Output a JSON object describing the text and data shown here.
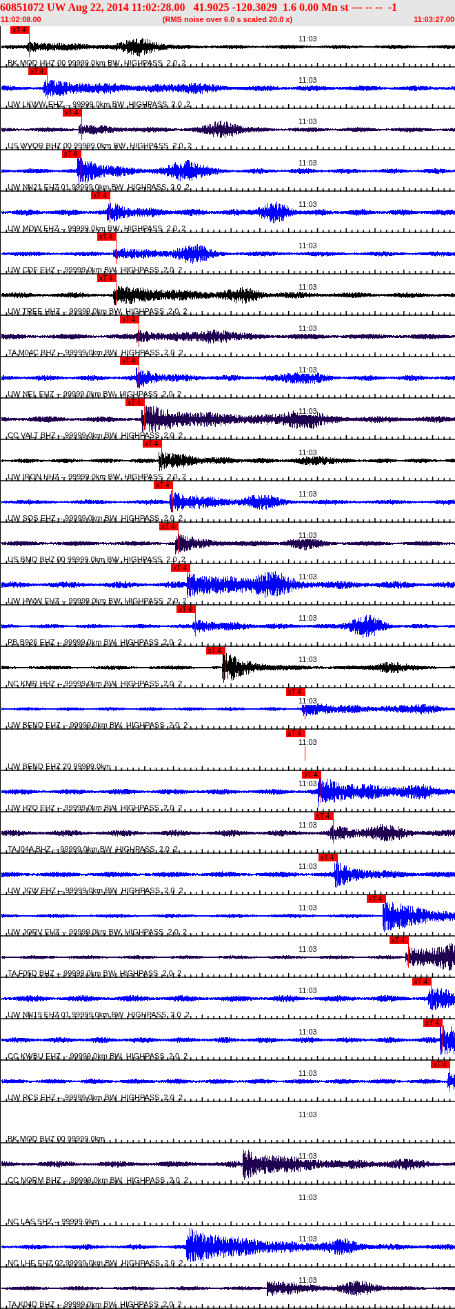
{
  "header": {
    "title": "60851072 UW Aug 22, 2014 11:02:28.00   41.9025 -120.3029  1.6 0.00 Mn st --- -- --  -1",
    "start_time": "11:02:08.00",
    "note": "(RMS noise over 6.0 s scaled 20.0 x)",
    "end_time": "11:03:27.00"
  },
  "traces": [
    {
      "kind": "trace",
      "label": "BK MOD HHZ 00 99999.0km BW  HIGHPASS  2.0  2",
      "color": "#000000",
      "time_mark": "11:03",
      "pick": "xT 4",
      "level": 0.064
    },
    {
      "kind": "trace",
      "label": "UW LKWW EHZ -- 99999.0km BW  HIGHPASS  2.0  2",
      "color": "#0000ff",
      "time_mark": "11:03",
      "pick": "xT 4",
      "level": 0.103
    },
    {
      "kind": "trace",
      "label": "US WVOR BHZ 00 99999.0km BW  HIGHPASS  2.0  2",
      "color": "#200050",
      "time_mark": "11:03",
      "pick": "xT 4",
      "level": 0.179
    },
    {
      "kind": "trace",
      "label": "UW NN21 EHZ 01 99999.0km BW  HIGHPASS  2.0  2",
      "color": "#0000ff",
      "time_mark": "11:03",
      "pick": "xT 4",
      "level": 0.177
    },
    {
      "kind": "trace",
      "label": "UW MDW EHZ -- 99999.0km BW  HIGHPASS  2.0  2",
      "color": "#0000ff",
      "time_mark": "11:03",
      "pick": "xT 4",
      "level": 0.242
    },
    {
      "kind": "trace",
      "label": "UW CDF EHZ -- 99999.0km BW  HIGHPASS  2.0  2",
      "color": "#0000ff",
      "time_mark": "11:03",
      "pick": "xT 4",
      "level": 0.255
    },
    {
      "kind": "trace",
      "label": "UW TREE HHZ -- 99999.0km BW  HIGHPASS  2.0  2",
      "color": "#000000",
      "time_mark": "11:03",
      "pick": "xT 4",
      "level": 0.255
    },
    {
      "kind": "trace",
      "label": "TA M04C BHZ -- 99999.0km BW  HIGHPASS  2.0  2",
      "color": "#200050",
      "time_mark": "11:03",
      "pick": "xT 4",
      "level": 0.305
    },
    {
      "kind": "trace",
      "label": "UW NEL EHZ -- 99999.0km BW  HIGHPASS  2.0  2",
      "color": "#0000ff",
      "time_mark": "11:03",
      "pick": "xT 4",
      "level": 0.305
    },
    {
      "kind": "trace",
      "label": "CC VALT BHZ -- 99999.0km BW  HIGHPASS  2.0  2",
      "color": "#200050",
      "time_mark": "11:03",
      "pick": "xT 4",
      "level": 0.317
    },
    {
      "kind": "trace",
      "label": "UW IRON HHZ -- 99999.0km BW  HIGHPASS  2.0  2",
      "color": "#000000",
      "time_mark": "11:03",
      "pick": "xT 4",
      "level": 0.355
    },
    {
      "kind": "trace",
      "label": "UW SOS EHZ -- 99999.0km BW  HIGHPASS  2.0  2",
      "color": "#0000ff",
      "time_mark": "11:03",
      "pick": "xT 4",
      "level": 0.38
    },
    {
      "kind": "trace",
      "label": "US BMO BHZ 00 99999.0km BW  HIGHPASS  2.0  2",
      "color": "#200050",
      "time_mark": "11:03",
      "pick": "xT 4",
      "level": 0.392
    },
    {
      "kind": "trace",
      "label": "UW HWW EHZ -- 99999.0km BW  HIGHPASS  2.0  2",
      "color": "#0000ff",
      "time_mark": "11:03",
      "pick": "xT 4",
      "level": 0.418
    },
    {
      "kind": "trace",
      "label": "PB B926 EHZ -- 99999.0km BW  HIGHPASS  2.0  2",
      "color": "#0000ff",
      "time_mark": "11:03",
      "pick": "xT 4",
      "level": 0.43
    },
    {
      "kind": "trace",
      "label": "NC KMR HHZ -- 99999.0km BW  HIGHPASS  2.0  2",
      "color": "#000000",
      "time_mark": "11:03",
      "pick": "xT 4",
      "level": 0.494
    },
    {
      "kind": "trace",
      "label": "UW BEND EHZ -- 99999.0km BW  HIGHPASS  2.0  2",
      "color": "#0000ff",
      "time_mark": "11:03",
      "pick": "xT 4",
      "level": 0.67
    },
    {
      "kind": "blank",
      "label": "UW BEND EHZ 20 99999.0km",
      "time_mark": "11:03",
      "pick": "xT 4",
      "level": 0.67
    },
    {
      "kind": "trace",
      "label": "UW H2O EHZ -- 99999.0km BW  HIGHPASS  2.0  2",
      "color": "#0000ff",
      "time_mark": "11:03",
      "pick": "xT 4",
      "level": 0.706
    },
    {
      "kind": "trace",
      "label": "TA I04A BHZ -- 99999.0km BW  HIGHPASS  2.0  2",
      "color": "#200050",
      "time_mark": "11:03",
      "pick": "xT 4",
      "level": 0.733
    },
    {
      "kind": "trace",
      "label": "UW JCW EHZ -- 99999.0km BW  HIGHPASS  2.0  2",
      "color": "#0000ff",
      "time_mark": "11:03",
      "pick": "xT 4",
      "level": 0.742
    },
    {
      "kind": "trace",
      "label": "UW JORV EHZ -- 99999.0km BW  HIGHPASS  2.0  2",
      "color": "#0000ff",
      "time_mark": "11:03",
      "pick": "xT 4",
      "level": 0.848
    },
    {
      "kind": "trace",
      "label": "TA F05D BHZ -- 99999.0km BW  HIGHPASS  2.0  2",
      "color": "#200050",
      "time_mark": "11:03",
      "pick": "xT 4",
      "level": 0.898
    },
    {
      "kind": "trace",
      "label": "UW NN19 EHZ 01 99999.0km BW  HIGHPASS  2.0  2",
      "color": "#0000ff",
      "time_mark": "11:03",
      "pick": "xT 4",
      "level": 0.948
    },
    {
      "kind": "trace",
      "label": "CC KWBU EHZ -- 99999.0km BW  HIGHPASS  2.0  2",
      "color": "#0000ff",
      "time_mark": "11:03",
      "pick": "xT 4",
      "level": 0.973
    },
    {
      "kind": "trace",
      "label": "UW RCS EHZ -- 99999.0km BW  HIGHPASS  2.0  2",
      "color": "#0000ff",
      "time_mark": "11:03",
      "pick": "xT 4",
      "level": 0.99
    },
    {
      "kind": "blank",
      "label": "BK MOD BHZ 00 99999.0km",
      "time_mark": "11:03"
    },
    {
      "kind": "trace",
      "label": "CC NORM BHZ -- 99999.0km BW  HIGHPASS  2.0  2",
      "color": "#200050",
      "time_mark": "11:03"
    },
    {
      "kind": "blank",
      "label": "NC LAS SHZ -- 99999.0km",
      "time_mark": "11:03"
    },
    {
      "kind": "trace",
      "label": "NC LHE EHZ 02 99999.0km BW  HIGHPASS  2.0  2",
      "color": "#0000ff",
      "time_mark": "11:03"
    },
    {
      "kind": "trace",
      "label": "TA K04D BHZ -- 99999.0km BW  HIGHPASS  2.0  2",
      "color": "#200050",
      "time_mark": "11:03"
    }
  ]
}
